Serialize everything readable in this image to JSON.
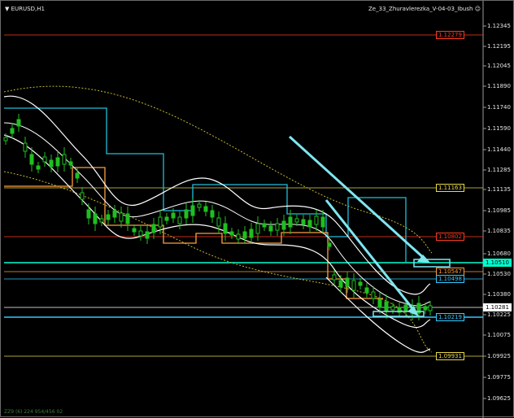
{
  "window": {
    "symbol_title": "EURUSD,H1",
    "indicator_name": "Ze_33_Zhuravlerezka_V-04-03_Ibush",
    "footer_text": "ZZ9 (6) 224 954/456 02",
    "menu_icon": "triangle-down-icon",
    "indicator_icon": "smiley-icon"
  },
  "price_axis": {
    "labels": [
      "1.12345",
      "1.12195",
      "1.12045",
      "1.11890",
      "1.11740",
      "1.11590",
      "1.11440",
      "1.11285",
      "1.11135",
      "1.10985",
      "1.10835",
      "1.10680",
      "1.10530",
      "1.10380",
      "1.10225",
      "1.10075",
      "1.09925",
      "1.09775",
      "1.09625"
    ]
  },
  "levels": [
    {
      "label": "1.12279",
      "color": "#ff3b1f"
    },
    {
      "label": "1.11163",
      "color": "#e8d84a"
    },
    {
      "label": "1.10802",
      "color": "#ff3b1f"
    },
    {
      "label": "1.10510",
      "color": "#00ffd0"
    },
    {
      "label": "1.10547",
      "color": "#ff9e3d"
    },
    {
      "label": "1.10498",
      "color": "#33c9ff"
    },
    {
      "label": "1.10281",
      "color": "#ffffff"
    },
    {
      "label": "1.10219",
      "color": "#33c9ff"
    },
    {
      "label": "1.09931",
      "color": "#e8d84a"
    }
  ],
  "colors": {
    "background": "#000000",
    "candles": "#1fbf1f",
    "envelope": "#ffffff",
    "trend_line": "#7fe6f0",
    "channel_upper": "#1fbfd9",
    "channel_lower": "#ff9e3d",
    "ma_dotted": "#c8b830"
  }
}
